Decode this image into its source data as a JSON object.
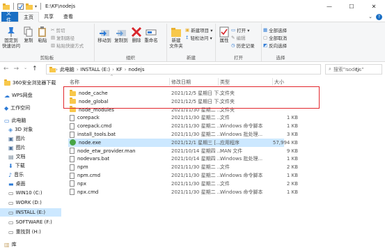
{
  "window": {
    "title_path": "E:\\KF\\nodejs",
    "controls": [
      "—",
      "☐",
      "✕"
    ]
  },
  "tabs": [
    {
      "label": "文件",
      "kind": "file"
    },
    {
      "label": "主页",
      "kind": "active"
    },
    {
      "label": "共享",
      "kind": "normal"
    },
    {
      "label": "查看",
      "kind": "normal"
    }
  ],
  "help": {
    "chevron": "⌄",
    "q": "?"
  },
  "ribbon": {
    "clipboard": {
      "label": "剪贴板",
      "pin": "固定到\n快速访问",
      "copy": "复制",
      "paste": "粘贴",
      "cut": "剪切",
      "copy_path": "复制路径",
      "paste_shortcut": "粘贴快捷方式"
    },
    "organize": {
      "label": "组织",
      "move_to": "移动到",
      "copy_to": "复制到",
      "delete": "删除",
      "rename": "重命名"
    },
    "new": {
      "label": "新建",
      "new_folder": "新建\n文件夹",
      "new_item": "新建项目 ▾",
      "easy_access": "轻松访问 ▾"
    },
    "open": {
      "label": "打开",
      "properties": "属性",
      "open": "打开 ▾",
      "edit": "编辑",
      "history": "历史记录"
    },
    "select": {
      "label": "选择",
      "select_all": "全部选择",
      "select_none": "全部取消",
      "invert": "反向选择"
    }
  },
  "address": {
    "crumbs": [
      "此电脑",
      "INSTALL (E:)",
      "KF",
      "nodejs"
    ],
    "search_placeholder": "搜索\"nodejs\""
  },
  "sidebar": {
    "items": [
      {
        "label": "360安全浏览器下载",
        "icon": "folder-icon"
      },
      {
        "label": "WPS网盘",
        "icon": "cloud-icon"
      },
      {
        "label": "工作空间",
        "icon": "workspace-icon"
      },
      {
        "label": "此电脑",
        "icon": "computer-icon"
      },
      {
        "label": "3D 对象",
        "icon": "cube-icon"
      },
      {
        "label": "图片",
        "icon": "image-icon"
      },
      {
        "label": "图片",
        "icon": "image-icon"
      },
      {
        "label": "文档",
        "icon": "document-icon"
      },
      {
        "label": "下载",
        "icon": "download-icon"
      },
      {
        "label": "音乐",
        "icon": "music-icon"
      },
      {
        "label": "桌面",
        "icon": "desktop-icon"
      },
      {
        "label": "WIN10 (C:)",
        "icon": "drive-icon"
      },
      {
        "label": "WORK (D:)",
        "icon": "drive-icon"
      },
      {
        "label": "INSTALL (E:)",
        "icon": "drive-icon"
      },
      {
        "label": "SOFTWARE (F:)",
        "icon": "drive-icon"
      },
      {
        "label": "重找到 (H:)",
        "icon": "drive-icon"
      },
      {
        "label": "库",
        "icon": "library-icon"
      }
    ],
    "selected_index": 13
  },
  "columns": {
    "name": "名称",
    "date": "修改日期",
    "type": "类型",
    "size": "大小",
    "sort_caret": "^"
  },
  "files": [
    {
      "name": "node_cache",
      "date": "2021/12/5 星期日 下...",
      "type": "文件夹",
      "size": "",
      "icon": "folder"
    },
    {
      "name": "node_global",
      "date": "2021/12/5 星期日 下...",
      "type": "文件夹",
      "size": "",
      "icon": "folder"
    },
    {
      "name": "node_modules",
      "date": "2021/11/30 星期二 ...",
      "type": "文件夹",
      "size": "",
      "icon": "folder"
    },
    {
      "name": "corepack",
      "date": "2021/11/30 星期二 ...",
      "type": "文件",
      "size": "1 KB",
      "icon": "doc"
    },
    {
      "name": "corepack.cmd",
      "date": "2021/11/30 星期二 ...",
      "type": "Windows 命令脚本",
      "size": "1 KB",
      "icon": "doc"
    },
    {
      "name": "install_tools.bat",
      "date": "2021/11/30 星期二 ...",
      "type": "Windows 批处理...",
      "size": "3 KB",
      "icon": "doc"
    },
    {
      "name": "node.exe",
      "date": "2021/12/1 星期三 [...",
      "type": "应用程序",
      "size": "57,994 KB",
      "icon": "exe"
    },
    {
      "name": "node_etw_provider.man",
      "date": "2021/10/14 星期四 ...",
      "type": "MAN 文件",
      "size": "9 KB",
      "icon": "doc"
    },
    {
      "name": "nodevars.bat",
      "date": "2021/10/14 星期四 ...",
      "type": "Windows 批处理...",
      "size": "1 KB",
      "icon": "doc"
    },
    {
      "name": "npm",
      "date": "2021/11/30 星期二 ...",
      "type": "文件",
      "size": "2 KB",
      "icon": "doc"
    },
    {
      "name": "npm.cmd",
      "date": "2021/11/30 星期二 ...",
      "type": "Windows 命令脚本",
      "size": "1 KB",
      "icon": "doc"
    },
    {
      "name": "npx",
      "date": "2021/11/30 星期二 ...",
      "type": "文件",
      "size": "2 KB",
      "icon": "doc"
    },
    {
      "name": "npx.cmd",
      "date": "2021/11/30 星期二 ...",
      "type": "Windows 命令脚本",
      "size": "1 KB",
      "icon": "doc"
    }
  ],
  "selected_file_index": 6
}
